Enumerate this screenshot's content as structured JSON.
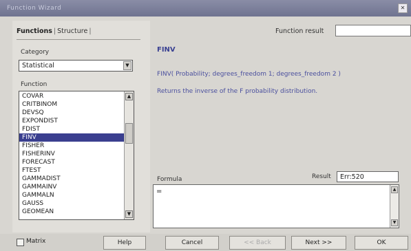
{
  "window": {
    "title": "Function Wizard"
  },
  "tabs": {
    "functions": "Functions",
    "structure": "Structure",
    "separator": "|"
  },
  "function_result": {
    "label": "Function result",
    "value": ""
  },
  "category": {
    "label": "Category",
    "value": "Statistical"
  },
  "function_list": {
    "label": "Function",
    "items": [
      "COVAR",
      "CRITBINOM",
      "DEVSQ",
      "EXPONDIST",
      "FDIST",
      "FINV",
      "FISHER",
      "FISHERINV",
      "FORECAST",
      "FTEST",
      "GAMMADIST",
      "GAMMAINV",
      "GAMMALN",
      "GAUSS",
      "GEOMEAN"
    ],
    "selected": "FINV"
  },
  "details": {
    "name": "FINV",
    "syntax": "FINV( Probability; degrees_freedom 1; degrees_freedom 2 )",
    "description": "Returns the inverse of the F probability distribution."
  },
  "formula": {
    "label": "Formula",
    "value": "="
  },
  "result": {
    "label": "Result",
    "value": "Err:520"
  },
  "buttons": {
    "matrix": "Matrix",
    "help": "Help",
    "cancel": "Cancel",
    "back": "<< Back",
    "next": "Next >>",
    "ok": "OK"
  },
  "colors": {
    "accent": "#3a4192",
    "selection": "#3a3f8f",
    "titlebar": "#7a7e99"
  }
}
